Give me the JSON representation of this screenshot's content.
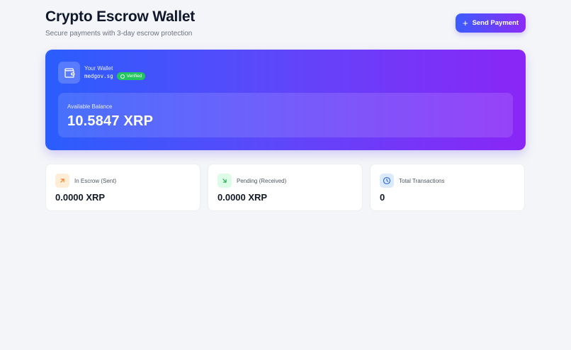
{
  "header": {
    "title": "Crypto Escrow Wallet",
    "subtitle": "Secure payments with 3-day escrow protection",
    "send_button_label": "Send Payment"
  },
  "wallet": {
    "label": "Your Wallet",
    "address": "medgov.sg",
    "verified_label": "Verified",
    "balance_label": "Available Balance",
    "balance_value": "10.5847 XRP"
  },
  "stats": [
    {
      "label": "In Escrow (Sent)",
      "value": "0.0000 XRP",
      "icon": "arrow-up-right-icon",
      "color": "#f97316"
    },
    {
      "label": "Pending (Received)",
      "value": "0.0000 XRP",
      "icon": "arrow-down-right-icon",
      "color": "#16a34a"
    },
    {
      "label": "Total Transactions",
      "value": "0",
      "icon": "clock-icon",
      "color": "#2563eb"
    }
  ],
  "colors": {
    "accent_start": "#2a5dfd",
    "accent_end": "#8a26f6",
    "verified": "#22c55e"
  }
}
